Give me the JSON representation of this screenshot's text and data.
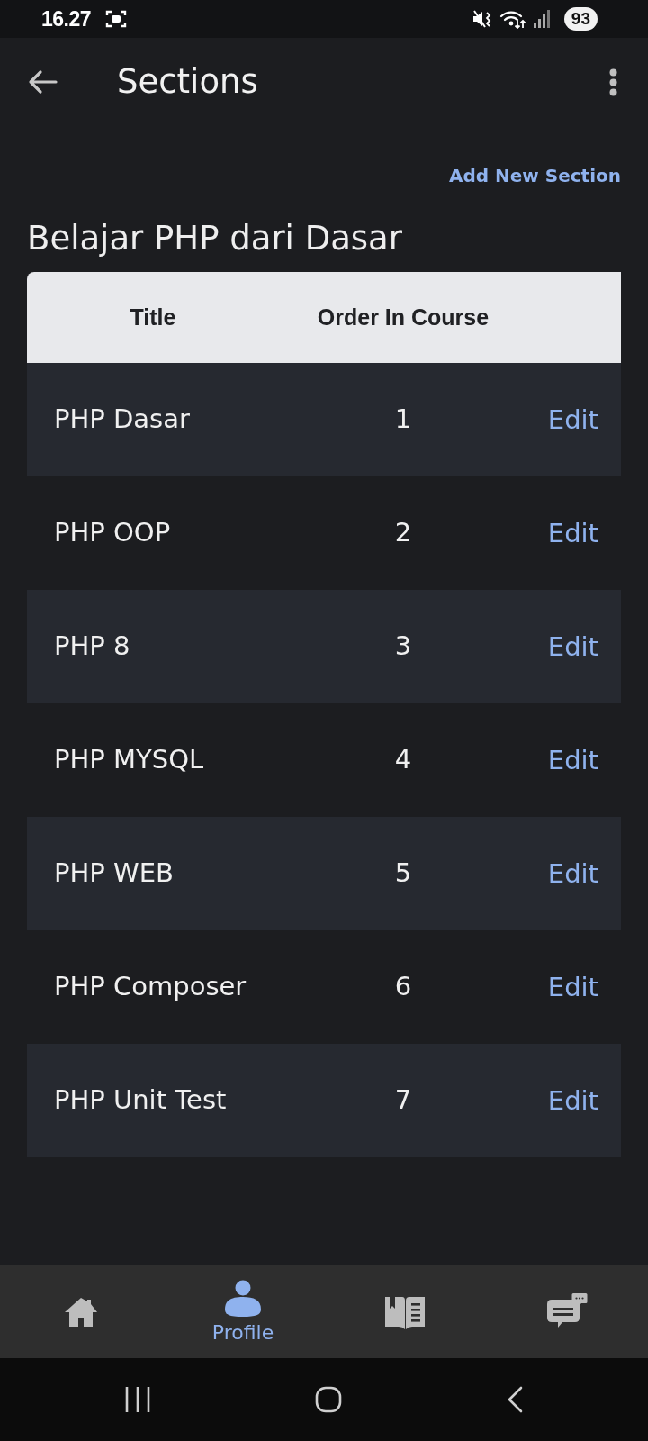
{
  "status_bar": {
    "time": "16.27",
    "battery": "93"
  },
  "app_bar": {
    "title": "Sections"
  },
  "add_section_link": "Add New Section",
  "course_title": "Belajar PHP dari Dasar",
  "table": {
    "columns": [
      "Title",
      "Order In Course"
    ],
    "rows": [
      {
        "title": "PHP Dasar",
        "order": "1",
        "action": "Edit"
      },
      {
        "title": "PHP OOP",
        "order": "2",
        "action": "Edit"
      },
      {
        "title": "PHP 8",
        "order": "3",
        "action": "Edit"
      },
      {
        "title": "PHP MYSQL",
        "order": "4",
        "action": "Edit"
      },
      {
        "title": "PHP WEB",
        "order": "5",
        "action": "Edit"
      },
      {
        "title": "PHP Composer",
        "order": "6",
        "action": "Edit"
      },
      {
        "title": "PHP Unit Test",
        "order": "7",
        "action": "Edit"
      }
    ]
  },
  "bottom_nav": [
    {
      "kind": "home",
      "selected": false
    },
    {
      "kind": "profile",
      "label": "Profile",
      "selected": true
    },
    {
      "kind": "book",
      "selected": false
    },
    {
      "kind": "chat",
      "selected": false
    }
  ]
}
